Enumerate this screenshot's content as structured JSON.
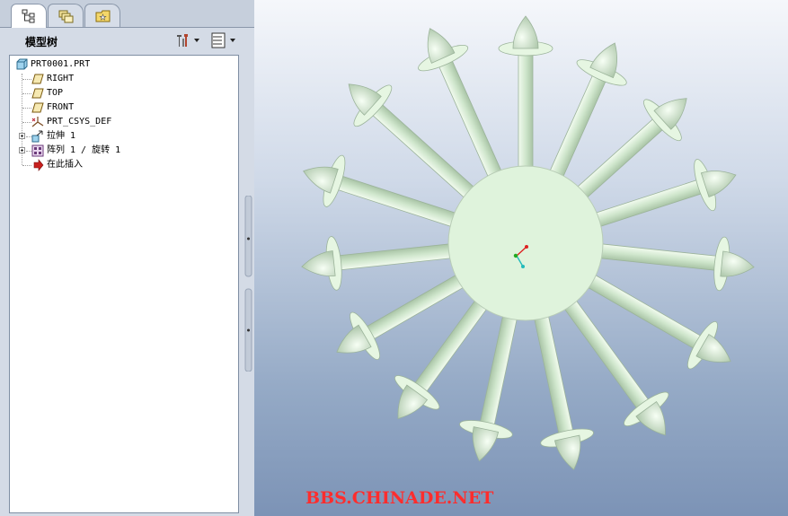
{
  "tabs": [
    {
      "icon": "model-tree-icon",
      "active": true
    },
    {
      "icon": "layers-icon",
      "active": false
    },
    {
      "icon": "favorites-folder-icon",
      "active": false
    }
  ],
  "panel": {
    "title": "模型树",
    "settings_icon": "tools-icon",
    "show_icon": "tree-columns-icon"
  },
  "tree": {
    "root": "PRT0001.PRT",
    "items": [
      {
        "label": "RIGHT",
        "icon": "datum-plane-icon"
      },
      {
        "label": "TOP",
        "icon": "datum-plane-icon"
      },
      {
        "label": "FRONT",
        "icon": "datum-plane-icon"
      },
      {
        "label": "PRT_CSYS_DEF",
        "icon": "coordinate-system-icon"
      },
      {
        "label": "拉伸 1",
        "icon": "extrude-icon"
      },
      {
        "label": "阵列 1 / 旋转 1",
        "icon": "pattern-icon"
      },
      {
        "label": "在此插入",
        "icon": "insert-here-arrow-icon"
      }
    ]
  },
  "watermark": "BBS.CHINADE.NET",
  "model": {
    "part_color": "#dff3dc",
    "arm_color": "#cfe6cc",
    "edge_color": "#9bb39a",
    "background_top": "#f5f7fb",
    "background_bottom": "#7c93b6",
    "arm_count": 15
  }
}
